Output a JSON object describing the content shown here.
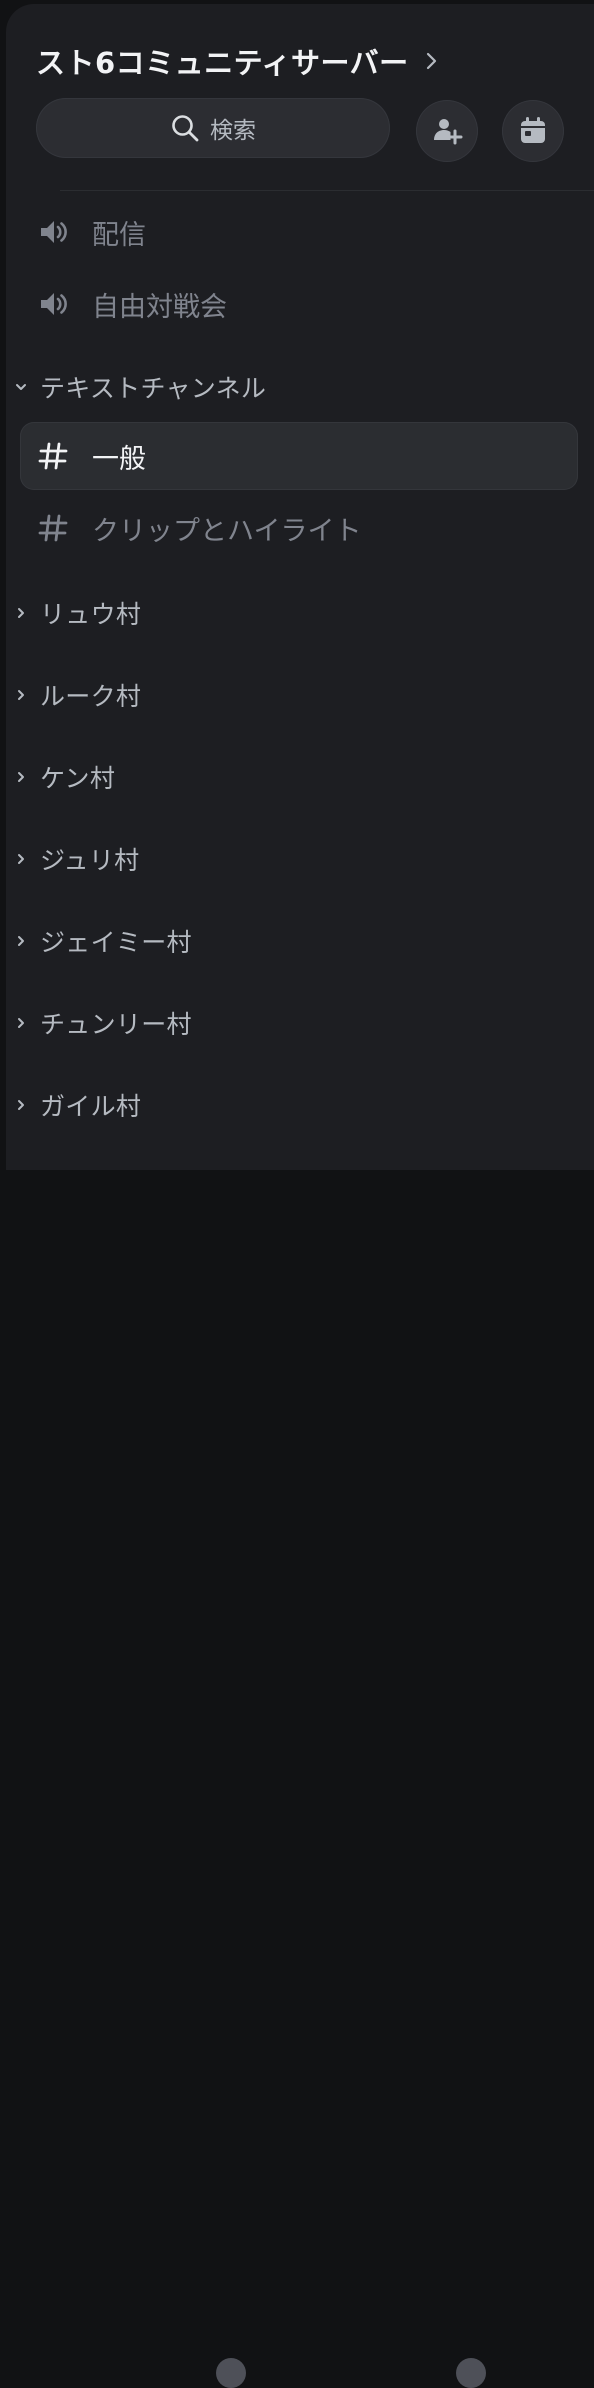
{
  "server": {
    "name": "スト6コミュニティサーバー"
  },
  "search": {
    "label": "検索"
  },
  "header_buttons": [
    {
      "icon": "invite-people-icon"
    },
    {
      "icon": "calendar-icon"
    }
  ],
  "voice_channels": [
    {
      "name": "配信",
      "icon": "speaker-icon"
    },
    {
      "name": "自由対戦会",
      "icon": "speaker-icon"
    }
  ],
  "text_category": {
    "name": "テキストチャンネル",
    "expanded": true
  },
  "text_channels": [
    {
      "name": "一般",
      "icon": "hash-icon",
      "active": true
    },
    {
      "name": "クリップとハイライト",
      "icon": "hash-icon",
      "active": false
    }
  ],
  "categories": [
    {
      "name": "リュウ村"
    },
    {
      "name": "ルーク村"
    },
    {
      "name": "ケン村"
    },
    {
      "name": "ジュリ村"
    },
    {
      "name": "ジェイミー村"
    },
    {
      "name": "チュンリー村"
    },
    {
      "name": "ガイル村"
    }
  ],
  "colors": {
    "background": "#1d1e22",
    "outer": "#111214",
    "active_channel": "#2b2d31",
    "text_primary": "#f2f3f5",
    "text_muted": "#80848e",
    "category_text": "#b5bac1"
  }
}
